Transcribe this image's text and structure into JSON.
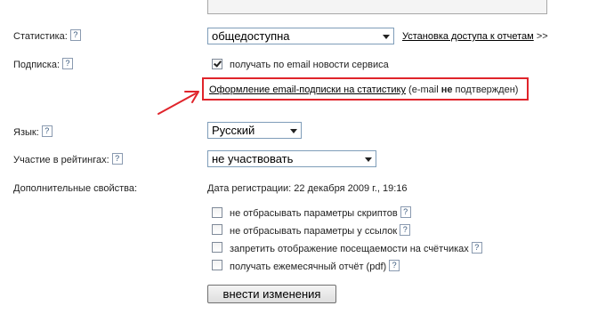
{
  "form": {
    "statistics": {
      "label": "Статистика:",
      "selected": "общедоступна",
      "access_link": "Установка доступа к отчетам",
      "access_link_suffix": ">>"
    },
    "subscription": {
      "label": "Подписка:",
      "checkbox_label": "получать по email новости сервиса",
      "checkbox_checked": true,
      "subscribe_link": "Оформление email-подписки на статистику",
      "note_prefix": " (e-mail ",
      "note_bold": "не",
      "note_suffix": " подтвержден)"
    },
    "language": {
      "label": "Язык:",
      "selected": "Русский"
    },
    "ratings": {
      "label": "Участие в рейтингах:",
      "selected": "не участвовать"
    },
    "extra": {
      "label": "Дополнительные свойства:",
      "registration": "Дата регистрации: 22 декабря 2009 г., 19:16",
      "options": [
        {
          "label": "не отбрасывать параметры скриптов",
          "checked": false
        },
        {
          "label": "не отбрасывать параметры у ссылок",
          "checked": false
        },
        {
          "label": "запретить отображение посещаемости на счётчиках",
          "checked": false
        },
        {
          "label": "получать ежемесячный отчёт (pdf)",
          "checked": false
        }
      ]
    },
    "submit_label": "внести изменения"
  },
  "colors": {
    "highlight_box": "#e0242b",
    "arrow": "#e0242b",
    "select_border": "#7f9db9"
  },
  "icons": [
    "help-icon",
    "dropdown-arrow-icon",
    "annotation-arrow-icon"
  ]
}
